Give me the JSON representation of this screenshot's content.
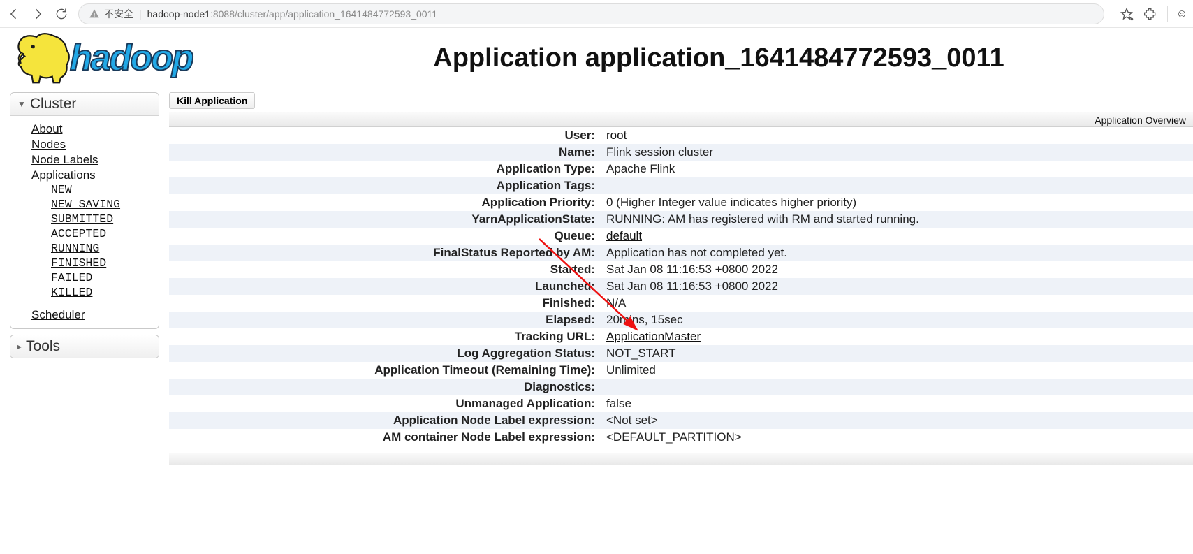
{
  "browser": {
    "insecure_label": "不安全",
    "url_host": "hadoop-node1",
    "url_port_path": ":8088/cluster/app/application_1641484772593_0011"
  },
  "page": {
    "title": "Application application_1641484772593_0011",
    "kill_label": "Kill Application",
    "overview_label": "Application Overview"
  },
  "sidebar": {
    "cluster_label": "Cluster",
    "tools_label": "Tools",
    "links": {
      "about": "About",
      "nodes": "Nodes",
      "node_labels": "Node Labels",
      "applications": "Applications",
      "scheduler": "Scheduler"
    },
    "app_states": {
      "new": "NEW",
      "new_saving": "NEW_SAVING",
      "submitted": "SUBMITTED",
      "accepted": "ACCEPTED",
      "running": "RUNNING",
      "finished": "FINISHED",
      "failed": "FAILED",
      "killed": "KILLED"
    }
  },
  "app": {
    "rows": [
      {
        "label": "User:",
        "value": "root",
        "link": true
      },
      {
        "label": "Name:",
        "value": "Flink session cluster"
      },
      {
        "label": "Application Type:",
        "value": "Apache Flink"
      },
      {
        "label": "Application Tags:",
        "value": ""
      },
      {
        "label": "Application Priority:",
        "value": "0 (Higher Integer value indicates higher priority)"
      },
      {
        "label": "YarnApplicationState:",
        "value": "RUNNING: AM has registered with RM and started running."
      },
      {
        "label": "Queue:",
        "value": "default",
        "link": true
      },
      {
        "label": "FinalStatus Reported by AM:",
        "value": "Application has not completed yet."
      },
      {
        "label": "Started:",
        "value": "Sat Jan 08 11:16:53 +0800 2022"
      },
      {
        "label": "Launched:",
        "value": "Sat Jan 08 11:16:53 +0800 2022"
      },
      {
        "label": "Finished:",
        "value": "N/A"
      },
      {
        "label": "Elapsed:",
        "value": "20mins, 15sec"
      },
      {
        "label": "Tracking URL:",
        "value": "ApplicationMaster",
        "link": true
      },
      {
        "label": "Log Aggregation Status:",
        "value": "NOT_START"
      },
      {
        "label": "Application Timeout (Remaining Time):",
        "value": "Unlimited"
      },
      {
        "label": "Diagnostics:",
        "value": ""
      },
      {
        "label": "Unmanaged Application:",
        "value": "false"
      },
      {
        "label": "Application Node Label expression:",
        "value": "<Not set>"
      },
      {
        "label": "AM container Node Label expression:",
        "value": "<DEFAULT_PARTITION>"
      }
    ]
  }
}
